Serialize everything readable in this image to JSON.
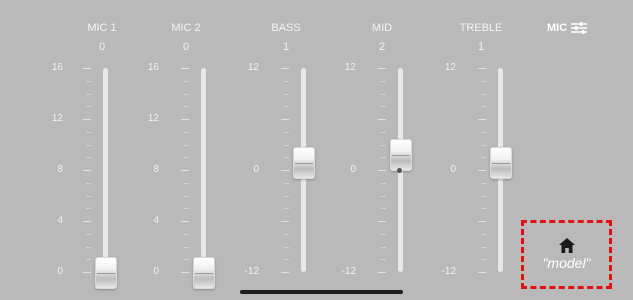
{
  "channels": [
    {
      "name": "MIC 1",
      "value": "0",
      "scale": [
        "16",
        "12",
        "8",
        "4",
        "0"
      ],
      "level": 0.0
    },
    {
      "name": "MIC 2",
      "value": "0",
      "scale": [
        "16",
        "12",
        "8",
        "4",
        "0"
      ],
      "level": 0.0
    },
    {
      "name": "BASS",
      "value": "1",
      "scale": [
        "12",
        "0",
        "-12"
      ],
      "level": 0.54
    },
    {
      "name": "MID",
      "value": "2",
      "scale": [
        "12",
        "0",
        "-12"
      ],
      "level": 0.58
    },
    {
      "name": "TREBLE",
      "value": "1",
      "scale": [
        "12",
        "0",
        "-12"
      ],
      "level": 0.54
    }
  ],
  "mic_button": {
    "label": "MIC",
    "icon": "sliders-icon"
  },
  "home_button": {
    "icon": "home-icon",
    "label": "\"model\""
  },
  "colors": {
    "background": "#b9b9b9",
    "highlight": "#e21010"
  }
}
